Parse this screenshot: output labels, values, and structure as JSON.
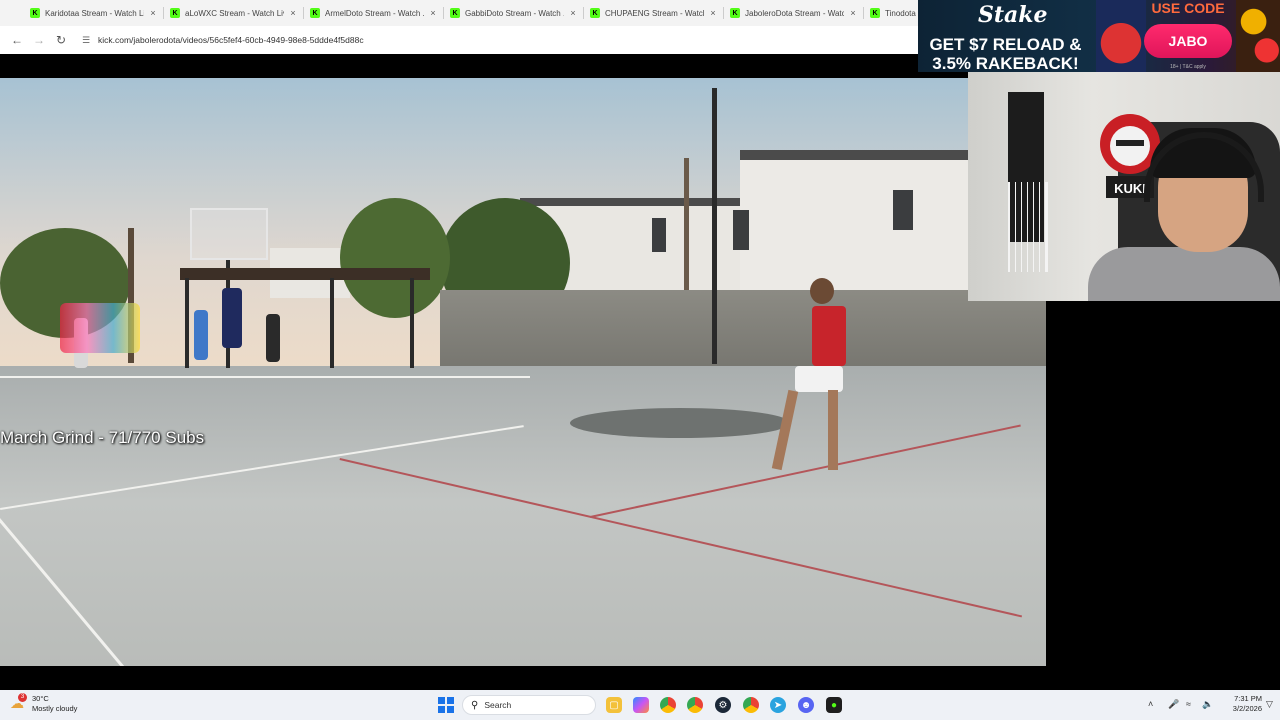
{
  "browser": {
    "tabs": [
      {
        "favicon": "K",
        "title": "Karidotaa Stream - Watch Li..."
      },
      {
        "favicon": "K",
        "title": "aLoWXC Stream - Watch Live"
      },
      {
        "favicon": "K",
        "title": "ArmelDoto Stream - Watch ..."
      },
      {
        "favicon": "K",
        "title": "GabbiDoto Stream - Watch ..."
      },
      {
        "favicon": "K",
        "title": "CHUPAENG Stream - Watch ..."
      },
      {
        "favicon": "K",
        "title": "JaboleroDota Stream - Watc..."
      },
      {
        "favicon": "K",
        "title": "Tinodota"
      }
    ],
    "tab_close_glyph": "×",
    "url": "kick.com/jabolerodota/videos/56c5fef4-60cb-4949-98e8-5ddde4f5d88c"
  },
  "stream": {
    "overlay_text": "March Grind - 71/770 Subs"
  },
  "ad": {
    "brand": "Stake",
    "headline_line1": "GET $7 RELOAD &",
    "headline_line2": "3.5% RAKEBACK!",
    "use_code_label": "USE CODE",
    "code": "JABO",
    "fine_print": "18+ | T&C apply"
  },
  "webcam": {
    "mascot_text": "KUKI"
  },
  "taskbar": {
    "weather": {
      "temp": "30°C",
      "condition": "Mostly cloudy",
      "badge": "3"
    },
    "search_placeholder": "Search",
    "clock_time": "7:31 PM",
    "clock_date": "3/2/2026"
  },
  "colors": {
    "kick_green": "#53fc18",
    "stake_pink": "#ff2a6d",
    "taskbar_bg": "#eef1f6"
  }
}
